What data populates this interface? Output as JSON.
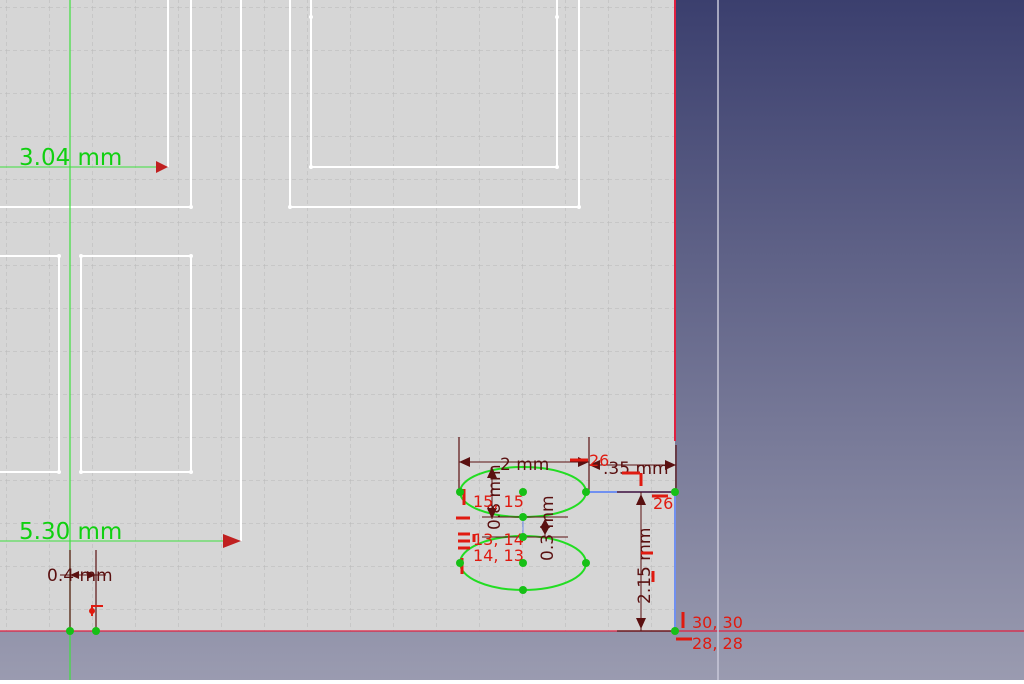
{
  "colors": {
    "sketch_background": "#d6d6d6",
    "view_background_top": "#3b3f6e",
    "view_background_bottom": "#9a9bb0",
    "grid_line": "#b8b8b8",
    "sketch_edge": "#ffffff",
    "axis_green": "#3ee03e",
    "axis_red": "#e02040",
    "construction_blue": "#7090f0",
    "dimension_green": "#10d010",
    "dimension_dark": "#5a1010",
    "constraint_red": "#e01a10",
    "ellipse_green": "#22dd22",
    "vertex_green": "#16c016"
  },
  "dimensions": {
    "d_3_04": "3.04 mm",
    "d_5_30": "5.30 mm",
    "d_0_4": "0.4 mm",
    "d_2": "2 mm",
    "d_0_35": ".35 mm",
    "d_0_3": "0.3 mm",
    "d_0_8": "0.8 mm",
    "d_2_15": "2.15 mm"
  },
  "constraints": {
    "c_26a": "26",
    "c_26b": "26",
    "c_15_15": "15, 15",
    "c_13_14": "13, 14",
    "c_14_13": "14, 13",
    "c_30_30": "30, 30",
    "c_28_28": "28, 28"
  }
}
